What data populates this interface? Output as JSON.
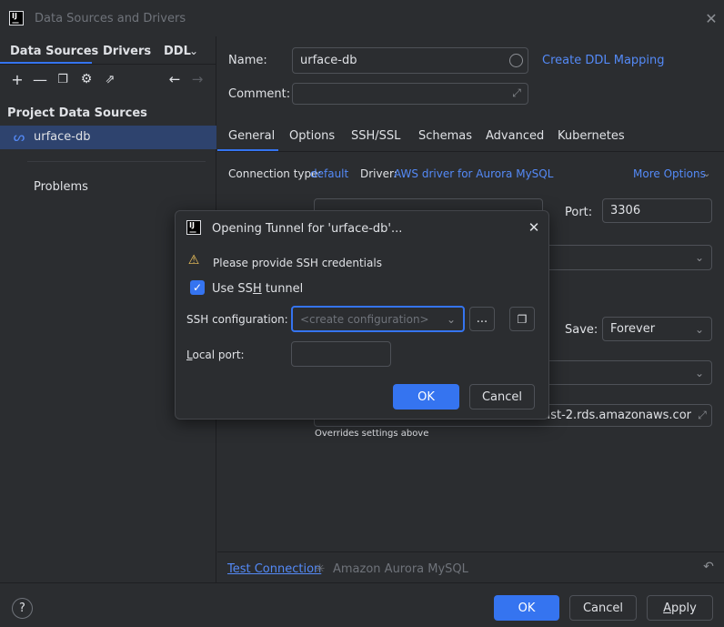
{
  "window": {
    "title": "Data Sources and Drivers"
  },
  "left": {
    "tabs": [
      "Data Sources",
      "Drivers",
      "DDL"
    ],
    "section_title": "Project Data Sources",
    "datasource_name": "urface-db",
    "problems": "Problems"
  },
  "right": {
    "name_label": "Name:",
    "name_value": "urface-db",
    "create_ddl": "Create DDL Mapping",
    "comment_label": "Comment:",
    "tabs": [
      "General",
      "Options",
      "SSH/SSL",
      "Schemas",
      "Advanced",
      "Kubernetes"
    ],
    "connection_type_label": "Connection type:",
    "connection_type_value": "default",
    "driver_label": "Driver:",
    "driver_value": "AWS driver for Aurora MySQL",
    "more_options": "More Options",
    "port_label": "Port:",
    "port_value": "3306",
    "save_label": "Save:",
    "save_value": "Forever",
    "url_value": "ortheast-2.rds.amazonaws.cor",
    "overrides_note": "Overrides settings above",
    "test_connection": "Test Connection",
    "test_status": "Amazon Aurora MySQL"
  },
  "dialog": {
    "title": "Opening Tunnel for 'urface-db'...",
    "warning": "Please provide SSH credentials",
    "use_ssh_pre": "Use SS",
    "use_ssh_mn": "H",
    "use_ssh_post": " tunnel",
    "ssh_config_label": "SSH configuration:",
    "ssh_config_placeholder": "<create configuration>",
    "browse": "...",
    "local_port_mn": "L",
    "local_port_rest": "ocal port:",
    "ok": "OK",
    "cancel": "Cancel"
  },
  "footer": {
    "help": "?",
    "ok": "OK",
    "cancel": "Cancel",
    "apply_mn": "A",
    "apply_rest": "pply"
  }
}
